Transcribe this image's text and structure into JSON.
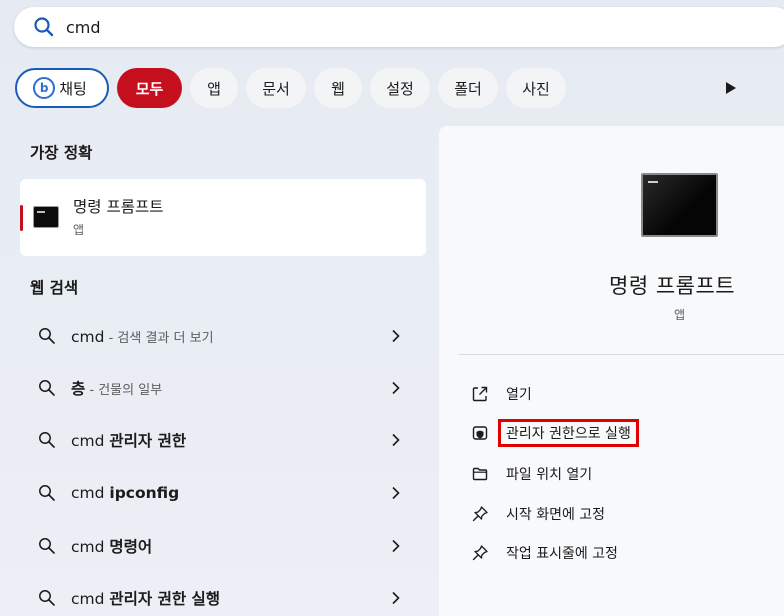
{
  "search": {
    "query": "cmd"
  },
  "filters": [
    "채팅",
    "모두",
    "앱",
    "문서",
    "웹",
    "설정",
    "폴더",
    "사진"
  ],
  "left": {
    "best_match_title": "가장 정확",
    "best_match": {
      "name": "명령 프롬프트",
      "type": "앱"
    },
    "web_search_title": "웹 검색",
    "results": [
      {
        "bold": "",
        "plain": "cmd",
        "sub": " - 검색 결과 더 보기"
      },
      {
        "bold": "층",
        "plain": "",
        "sub": " - 건물의 일부"
      },
      {
        "plain": "cmd ",
        "bold": "관리자 권한",
        "sub": ""
      },
      {
        "plain": "cmd ",
        "bold": "ipconfig",
        "sub": ""
      },
      {
        "plain": "cmd ",
        "bold": "명령어",
        "sub": ""
      },
      {
        "plain": "cmd ",
        "bold": "관리자 권한 실행",
        "sub": ""
      }
    ]
  },
  "preview": {
    "title": "명령 프롬프트",
    "type": "앱",
    "actions": [
      {
        "label": "열기",
        "icon": "open-icon"
      },
      {
        "label": "관리자 권한으로 실행",
        "icon": "shield-icon",
        "highlighted": true
      },
      {
        "label": "파일 위치 열기",
        "icon": "folder-icon"
      },
      {
        "label": "시작 화면에 고정",
        "icon": "pin-icon"
      },
      {
        "label": "작업 표시줄에 고정",
        "icon": "pin-icon"
      }
    ]
  },
  "colors": {
    "accent_red": "#c50f1f",
    "highlight_border": "#e00000",
    "chat_border": "#1a5bb7"
  }
}
